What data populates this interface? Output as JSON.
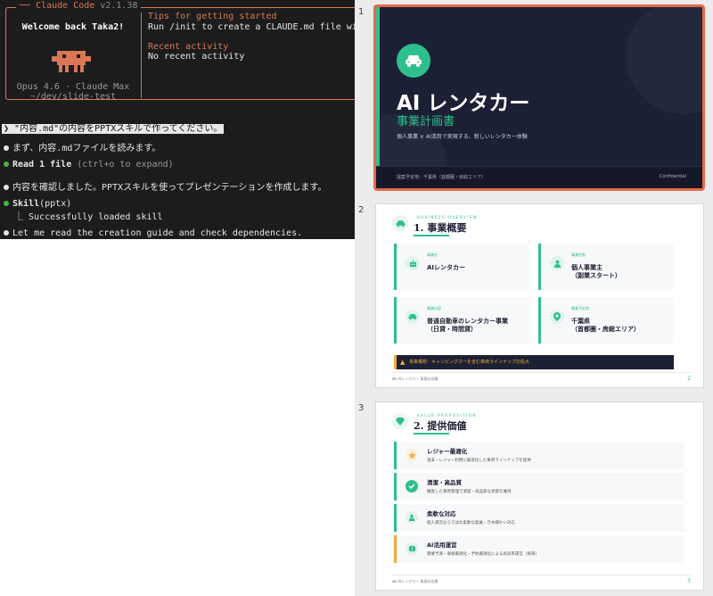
{
  "terminal": {
    "app_title": "Claude Code",
    "version": "v2.1.38",
    "welcome": "Welcome back Taka2!",
    "model": "Opus 4.6 · Claude Max",
    "cwd": "~/dev/slide-test",
    "tips_heading": "Tips for getting started",
    "tips_text": "Run /init to create a CLAUDE.md file with",
    "recent_heading": "Recent activity",
    "recent_text": "No recent activity",
    "prompt_marker": "❯",
    "prompt_text": " \"内容.md\"の内容をPPTXスキルで作ってください。",
    "line1": "まず、内容.mdファイルを読みます。",
    "line2_bold": "Read 1 file",
    "line2_hint": " (ctrl+o to expand)",
    "line3": "内容を確認しました。PPTXスキルを使ってプレゼンテーションを作成します。",
    "line4_bold": "Skill",
    "line4_arg": "(pptx)",
    "line4_sub": "⎿  Successfully loaded skill",
    "line5": "Let me read the creation guide and check dependencies.",
    "colors": {
      "accent": "#d97757",
      "bg": "#1c1c1c",
      "success": "#4caf50"
    }
  },
  "slides": {
    "numbers": [
      "1",
      "2",
      "3"
    ],
    "accent": "#2fbf8f",
    "s1": {
      "icon": "car-icon",
      "title": "AI レンタカー",
      "subtitle": "事業計画書",
      "desc": "個人事業 × AI活用で実現する、新しいレンタカー体験",
      "footer_left": "提案予定地：千葉県（首都圏・房総エリア）",
      "footer_right": "Confidential"
    },
    "s2": {
      "kicker": "BUSINESS OVERVIEW",
      "title": "1. 事業概要",
      "cards": [
        {
          "label": "事業名",
          "value": "AIレンタカー",
          "icon": "robot-icon"
        },
        {
          "label": "事業形態",
          "value": "個人事業主\n（副業スタート）",
          "icon": "person-icon"
        },
        {
          "label": "事業内容",
          "value": "普通自動車のレンタカー事業\n（日貸・時間貸）",
          "icon": "car-icon"
        },
        {
          "label": "事業予定地",
          "value": "千葉県\n（首都圏・房総エリア）",
          "icon": "location-pin-icon"
        }
      ],
      "banner": "将来構想：キャンピングカーを含む車両ラインナップの拡大",
      "footer": "AIレンタカー 事業計画書",
      "page": "2"
    },
    "s3": {
      "kicker": "VALUE PROPOSITION",
      "title": "2. 提供価値",
      "rows": [
        {
          "title": "レジャー最適化",
          "desc": "週末・レジャー利用に最適化した車両ラインナップを提供",
          "icon": "star-icon"
        },
        {
          "title": "清潔・高品質",
          "desc": "徹底した車両管理で清潔・高品質な状態を維持",
          "icon": "check-icon"
        },
        {
          "title": "柔軟な対応",
          "desc": "個人運営ならではの柔軟な発展・きめ細かい対応",
          "icon": "person-icon"
        },
        {
          "title": "AI活用運営",
          "desc": "需要予測・価格最適化・予約最適化による高効率運営（将来）",
          "icon": "brain-icon"
        }
      ],
      "footer": "AIレンタカー 事業計画書",
      "page": "3"
    }
  }
}
